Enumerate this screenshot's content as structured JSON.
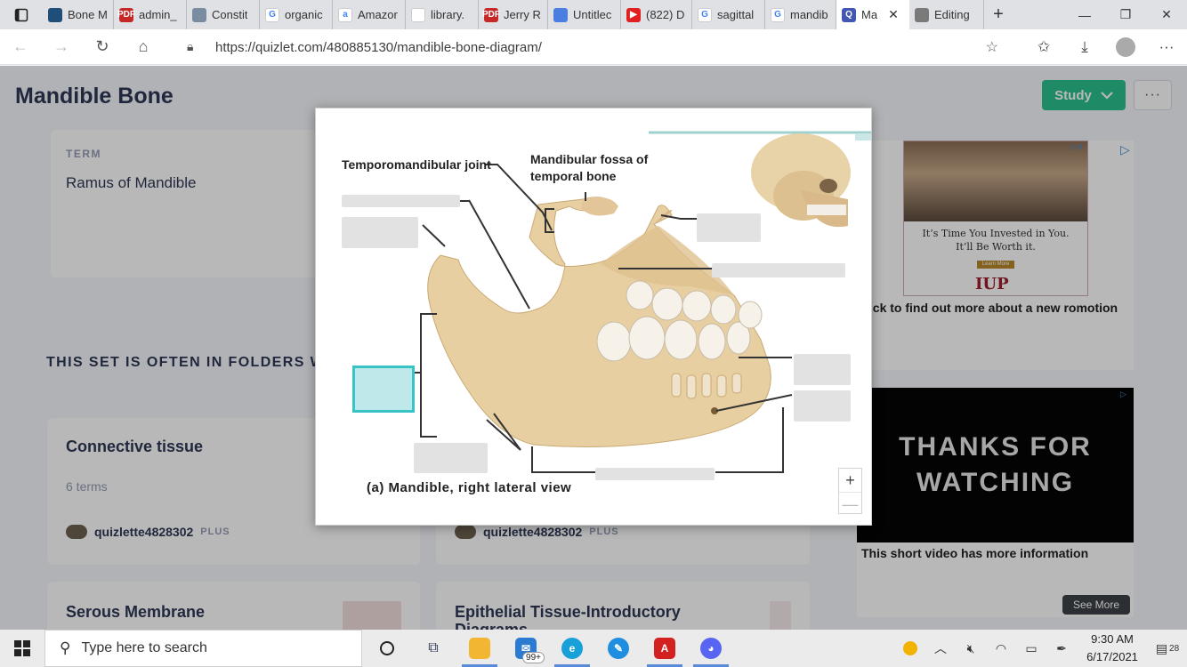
{
  "browser": {
    "tabs": [
      {
        "title": "Bone M",
        "color": "#1f4e79",
        "glyph": ""
      },
      {
        "title": "admin_",
        "color": "#c62828",
        "glyph": "PDF"
      },
      {
        "title": "Constit",
        "color": "#7a8ca0",
        "glyph": ""
      },
      {
        "title": "organic",
        "color": "#ffffff",
        "glyph": "G"
      },
      {
        "title": "Amazor",
        "color": "#ffffff",
        "glyph": "a"
      },
      {
        "title": "library.",
        "color": "#ffffff",
        "glyph": ""
      },
      {
        "title": "Jerry R.",
        "color": "#c62828",
        "glyph": "PDF"
      },
      {
        "title": "Untitlec",
        "color": "#4a7ee0",
        "glyph": ""
      },
      {
        "title": "(822) D",
        "color": "#e02020",
        "glyph": "▶"
      },
      {
        "title": "sagittal",
        "color": "#ffffff",
        "glyph": "G"
      },
      {
        "title": "mandib",
        "color": "#ffffff",
        "glyph": "G"
      },
      {
        "title": "Ma",
        "color": "#4257b2",
        "glyph": "Q"
      },
      {
        "title": "Editing",
        "color": "#7a7a7a",
        "glyph": ""
      }
    ],
    "url": "https://quizlet.com/480885130/mandible-bone-diagram/"
  },
  "page": {
    "title": "Mandible Bone",
    "study_label": "Study",
    "more_label": "···",
    "term_label": "TERM",
    "term_value": "Ramus of Mandible",
    "folders_heading": "THIS SET IS OFTEN IN FOLDERS W",
    "sets": [
      {
        "title": "Connective tissue",
        "terms": "6 terms",
        "author": "quizlette4828302",
        "badge": "PLUS"
      },
      {
        "title": "",
        "terms": "",
        "author": "quizlette4828302",
        "badge": "PLUS"
      },
      {
        "title": "Serous Membrane"
      },
      {
        "title": "Epithelial Tissue-Introductory Diagrams"
      }
    ],
    "ad": {
      "text_line1": "It’s Time You Invested in You.",
      "text_line2": "It’ll Be Worth it.",
      "learn_more": "Learn More",
      "logo": "IUP",
      "caption": "lick to find out more about a new romotion"
    },
    "video": {
      "overlay_text": "THANKS FOR WATCHING",
      "caption": "This short video has more information",
      "see_more": "See More"
    }
  },
  "diagram": {
    "label_tmj": "Temporomandibular joint",
    "label_fossa": "Mandibular fossa of temporal bone",
    "caption": "(a) Mandible, right lateral view",
    "zoom_in": "+",
    "zoom_out": "—"
  },
  "taskbar": {
    "search_placeholder": "Type here to search",
    "mail_badge": "99+",
    "time": "9:30 AM",
    "date": "6/17/2021",
    "notifications": "28"
  }
}
